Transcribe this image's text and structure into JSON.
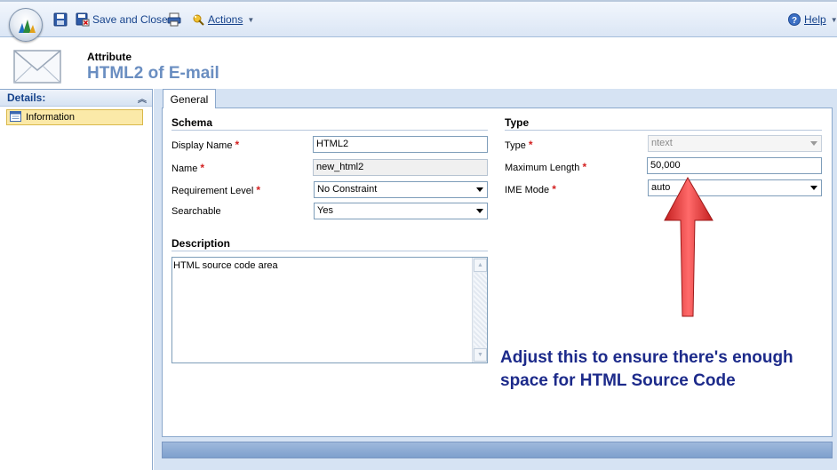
{
  "toolbar": {
    "save_label": "",
    "save_close_label": "Save and Close",
    "print_label": "",
    "actions_label": "Actions",
    "help_label": "Help"
  },
  "header": {
    "entity_type": "Attribute",
    "record_title": "HTML2 of E-mail"
  },
  "nav": {
    "section_label": "Details:",
    "items": [
      {
        "label": "Information",
        "selected": true
      }
    ]
  },
  "tabs": [
    {
      "label": "General",
      "active": true
    }
  ],
  "schema": {
    "title": "Schema",
    "fields": {
      "display_name": {
        "label": "Display Name",
        "value": "HTML2",
        "required": true
      },
      "name": {
        "label": "Name",
        "value": "new_html2",
        "required": true,
        "readonly": true
      },
      "requirement_level": {
        "label": "Requirement Level",
        "value": "No Constraint",
        "required": true
      },
      "searchable": {
        "label": "Searchable",
        "value": "Yes",
        "required": false
      }
    }
  },
  "description": {
    "title": "Description",
    "value": "HTML source code area"
  },
  "type_section": {
    "title": "Type",
    "fields": {
      "type": {
        "label": "Type",
        "value": "ntext",
        "required": true,
        "disabled": true
      },
      "max_length": {
        "label": "Maximum Length",
        "value": "50,000",
        "required": true
      },
      "ime_mode": {
        "label": "IME Mode",
        "value": "auto",
        "required": true
      }
    }
  },
  "annotation": {
    "line1": "Adjust this to ensure there's enough",
    "line2": "space for HTML Source Code",
    "color": "#1c2a8a",
    "arrow_color": "#e03a3a"
  },
  "colors": {
    "accent": "#15428b",
    "title_blue": "#6a8ec1",
    "required": "#d32020",
    "panel_bg": "#d6e3f3",
    "selected_item": "#fbe9a8"
  }
}
